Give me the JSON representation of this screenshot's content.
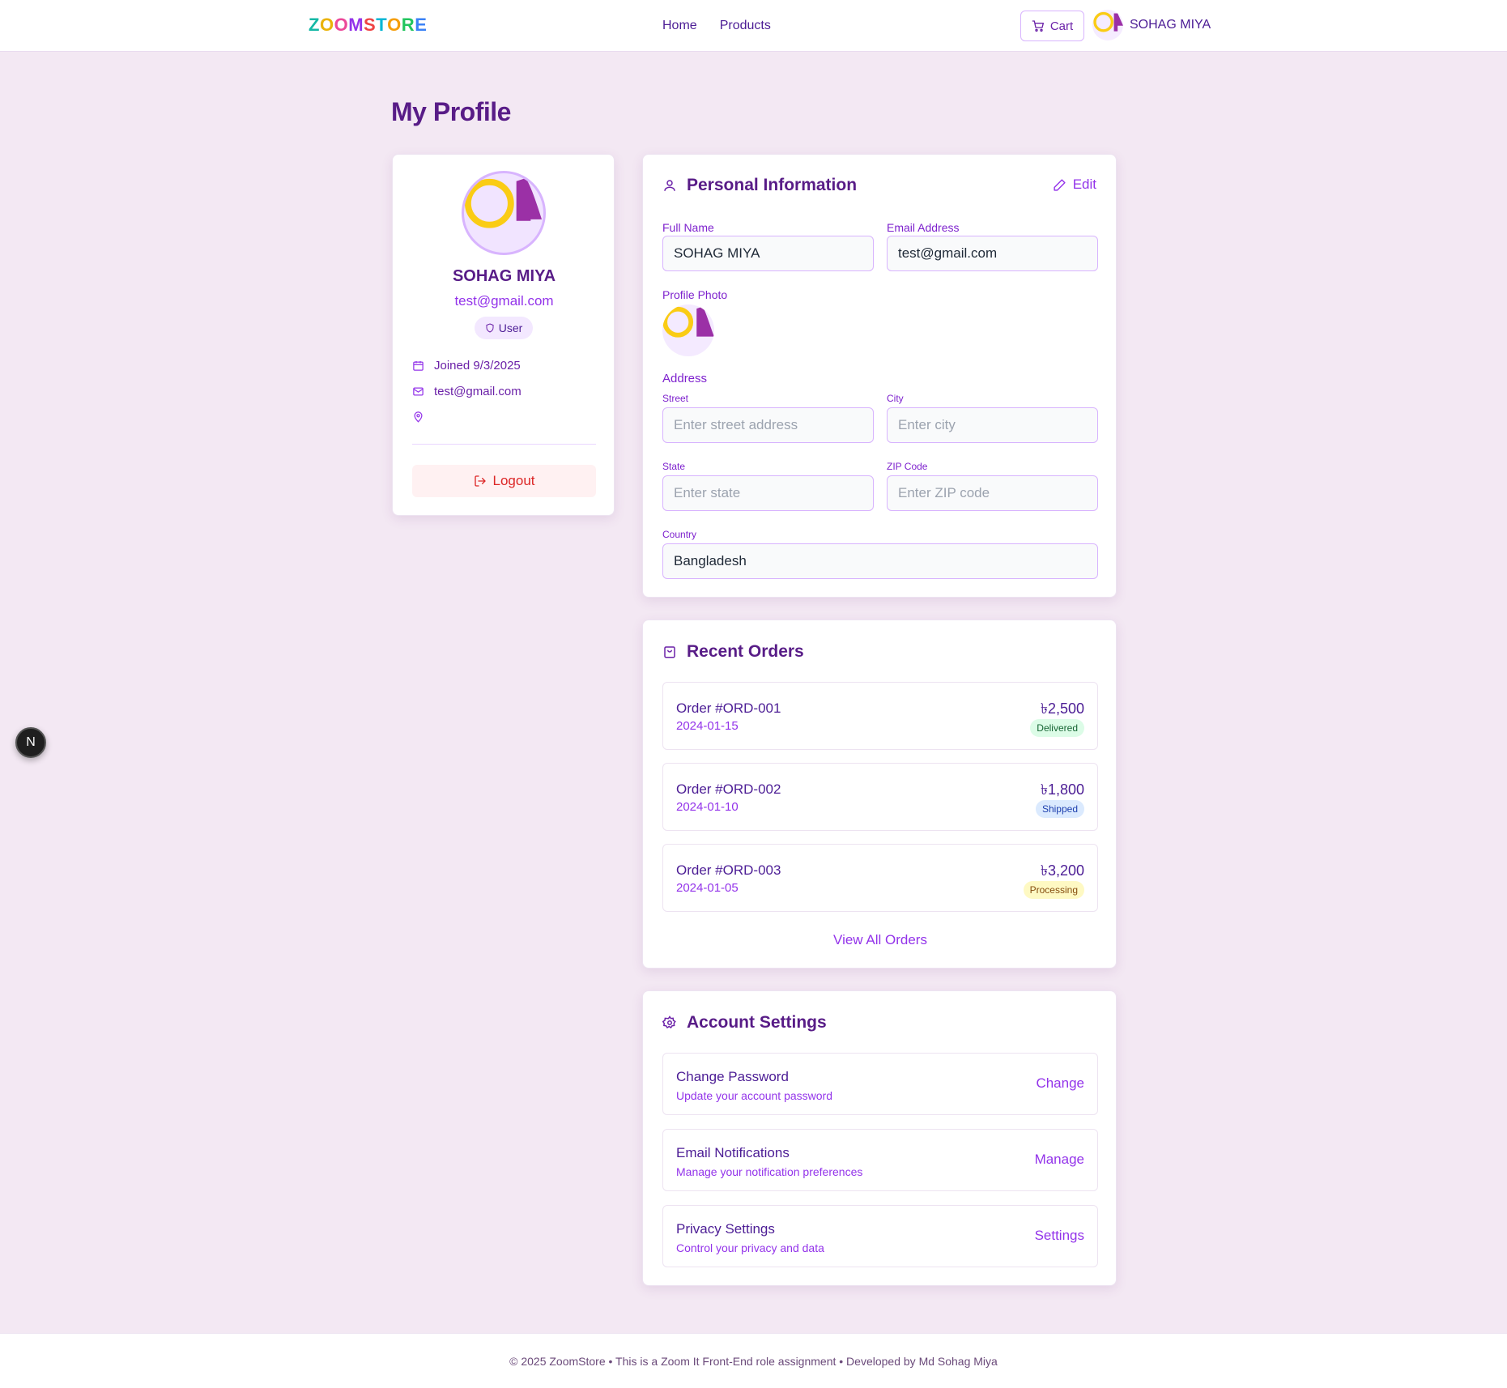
{
  "header": {
    "logo_letters": [
      "Z",
      "O",
      "O",
      "M",
      "S",
      "T",
      "O",
      "R",
      "E"
    ],
    "logo_colors": [
      "#14b8a6",
      "#eab308",
      "#ec4899",
      "#9333ea",
      "#ef4444",
      "#06b6d4",
      "#f59e0b",
      "#22c55e",
      "#3b82f6"
    ],
    "nav": [
      {
        "label": "Home"
      },
      {
        "label": "Products"
      }
    ],
    "cart_label": "Cart",
    "user_name": "SOHAG MIYA"
  },
  "page_title": "My Profile",
  "profile_card": {
    "name": "SOHAG MIYA",
    "email": "test@gmail.com",
    "role": "User",
    "joined": "Joined 9/3/2025",
    "contact_email": "test@gmail.com",
    "location": "",
    "logout_label": "Logout"
  },
  "personal_info": {
    "title": "Personal Information",
    "edit_label": "Edit",
    "full_name_label": "Full Name",
    "full_name_value": "SOHAG MIYA",
    "email_label": "Email Address",
    "email_value": "test@gmail.com",
    "photo_label": "Profile Photo",
    "address_label": "Address",
    "street_label": "Street",
    "street_placeholder": "Enter street address",
    "city_label": "City",
    "city_placeholder": "Enter city",
    "state_label": "State",
    "state_placeholder": "Enter state",
    "zip_label": "ZIP Code",
    "zip_placeholder": "Enter ZIP code",
    "country_label": "Country",
    "country_value": "Bangladesh"
  },
  "recent_orders": {
    "title": "Recent Orders",
    "orders": [
      {
        "id": "Order #ORD-001",
        "date": "2024-01-15",
        "price": "৳2,500",
        "status": "Delivered"
      },
      {
        "id": "Order #ORD-002",
        "date": "2024-01-10",
        "price": "৳1,800",
        "status": "Shipped"
      },
      {
        "id": "Order #ORD-003",
        "date": "2024-01-05",
        "price": "৳3,200",
        "status": "Processing"
      }
    ],
    "view_all_label": "View All Orders"
  },
  "account_settings": {
    "title": "Account Settings",
    "items": [
      {
        "title": "Change Password",
        "desc": "Update your account password",
        "action": "Change"
      },
      {
        "title": "Email Notifications",
        "desc": "Manage your notification preferences",
        "action": "Manage"
      },
      {
        "title": "Privacy Settings",
        "desc": "Control your privacy and data",
        "action": "Settings"
      }
    ]
  },
  "status_colors": {
    "delivered_bg": "#dcfce7",
    "delivered_fg": "#166534",
    "shipped_bg": "#dbeafe",
    "shipped_fg": "#1e40af",
    "processing_bg": "#fef9c3",
    "processing_fg": "#854d0e"
  },
  "dev_badge": "N",
  "footer": "© 2025 ZoomStore • This is a Zoom It Front-End role assignment • Developed by Md Sohag Miya"
}
